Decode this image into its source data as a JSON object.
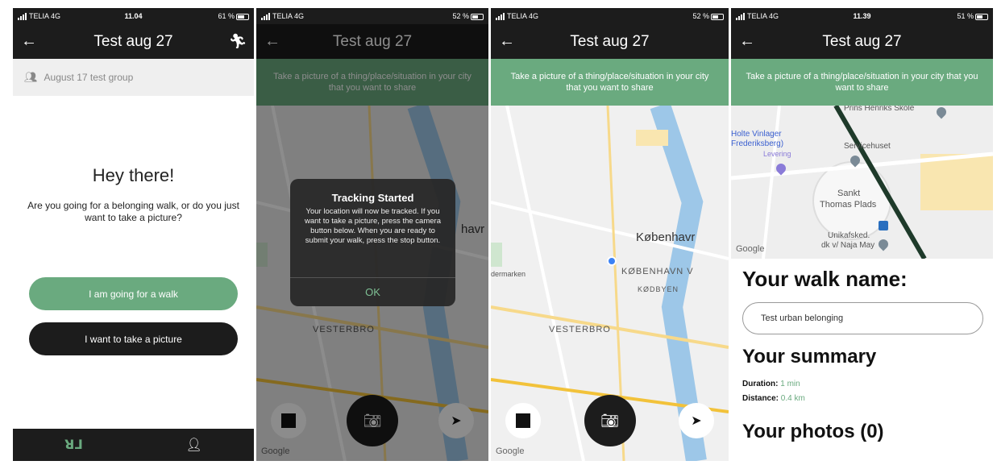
{
  "colors": {
    "accent": "#6aaa7f",
    "dark": "#1c1c1c"
  },
  "screens": [
    {
      "status": {
        "carrier": "TELIA 4G",
        "time": "11.04",
        "right": "61 %"
      },
      "title": "Test aug 27",
      "action_icon": "running-figure-icon",
      "group": "August 17 test group",
      "greeting": "Hey there!",
      "question": "Are you going for a belonging walk, or do you just want to take a picture?",
      "walk_button": "I am going for a walk",
      "picture_button": "I want to take a picture",
      "tabs": [
        "logo-icon",
        "user-icon"
      ]
    },
    {
      "status": {
        "carrier": "TELIA 4G",
        "time": "",
        "right": "52 %"
      },
      "title": "Test aug 27",
      "banner": "Take a picture of a thing/place/situation in your city that you want to share",
      "dialog": {
        "title": "Tracking Started",
        "body": "Your location will now be tracked. If you want to take a picture, press the camera button below. When you are ready to submit your walk, press the stop button.",
        "ok": "OK"
      },
      "map_labels": {
        "vesterbro": "VESTERBRO",
        "kobenhavn": "havr"
      },
      "google": "Google"
    },
    {
      "status": {
        "carrier": "TELIA 4G",
        "time": "",
        "right": "52 %"
      },
      "title": "Test aug 27",
      "banner": "Take a picture of a thing/place/situation in your city that you want to share",
      "map_labels": {
        "kobenhavn": "Københavr",
        "kobenhavn_v": "KØBENHAVN V",
        "kodbyen": "KØDBYEN",
        "vesterbro": "VESTERBRO",
        "dermarken": "dermarken"
      },
      "google": "Google"
    },
    {
      "status": {
        "carrier": "TELIA 4G",
        "time": "11.39",
        "right": "51 %"
      },
      "title": "Test aug 27",
      "banner": "Take a picture of a thing/place/situation in your city that you want to share",
      "map_labels": {
        "prins": "Prins Henriks Skole",
        "holte": "Holte Vinlager",
        "frederiksberg": "Frederiksberg)",
        "levering": "Levering",
        "servicehuset": "Servicehuset",
        "sankt": "Sankt",
        "thomas": "Thomas Plads",
        "unikafsked": "Unikafsked.",
        "dk": "dk v/ Naja May"
      },
      "google": "Google",
      "walk_name_heading": "Your walk name:",
      "walk_name_value": "Test urban belonging",
      "summary_heading": "Your summary",
      "duration_label": "Duration:",
      "duration_value": "1 min",
      "distance_label": "Distance:",
      "distance_value": "0.4 km",
      "photos_heading": "Your photos (0)"
    }
  ]
}
